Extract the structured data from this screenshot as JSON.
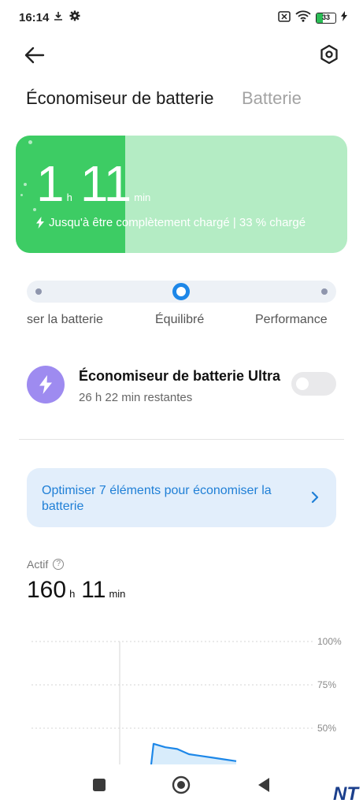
{
  "status_bar": {
    "time": "16:14",
    "battery_percent": "33",
    "icons": [
      "download-icon",
      "gear-icon",
      "sim-off-icon",
      "wifi-icon",
      "battery-icon",
      "charging-bolt-icon"
    ]
  },
  "header": {
    "back_icon": "arrow-left-icon",
    "settings_icon": "hexagon-settings-icon"
  },
  "tabs": [
    {
      "label": "Économiseur de batterie",
      "active": true
    },
    {
      "label": "Batterie",
      "active": false
    }
  ],
  "battery_card": {
    "hours": "1",
    "hours_unit": "h",
    "minutes": "11",
    "minutes_unit": "min",
    "subtitle": "Jusqu'à être complètement chargé | 33 % chargé",
    "level_fraction": 0.33,
    "color_full": "#3dcc64",
    "color_empty": "#b4ecc4"
  },
  "modes": {
    "labels": [
      "Économiser la batterie",
      "Équilibré",
      "Performance"
    ],
    "visible_label_left": "ser la batterie",
    "selected_index": 1,
    "accent": "#1d87e8"
  },
  "ultra_saver": {
    "title": "Économiseur de batterie Ultra",
    "subtitle": "26 h 22 min restantes",
    "enabled": false,
    "icon": "bolt-icon",
    "icon_color": "#9e8bf0"
  },
  "optimize": {
    "text": "Optimiser 7 éléments pour économiser la batterie",
    "color": "#1f7fd6"
  },
  "active": {
    "label": "Actif",
    "hours": "160",
    "hours_unit": "h",
    "minutes": "11",
    "minutes_unit": "min"
  },
  "chart_data": {
    "type": "area",
    "y_ticks": [
      "100%",
      "75%",
      "50%"
    ],
    "ylim": [
      0,
      100
    ],
    "series": [
      {
        "values": [
          null,
          null,
          null,
          41,
          39,
          38,
          35,
          34,
          33,
          32,
          31
        ]
      }
    ],
    "current_value": 33,
    "line_color": "#1d87e8",
    "fill_color": "#d8ecfb",
    "marker_color": "#2bbd56"
  },
  "nav_bar": {
    "buttons": [
      "recents-square-icon",
      "home-circle-icon",
      "back-triangle-icon"
    ]
  },
  "watermark": "NT"
}
